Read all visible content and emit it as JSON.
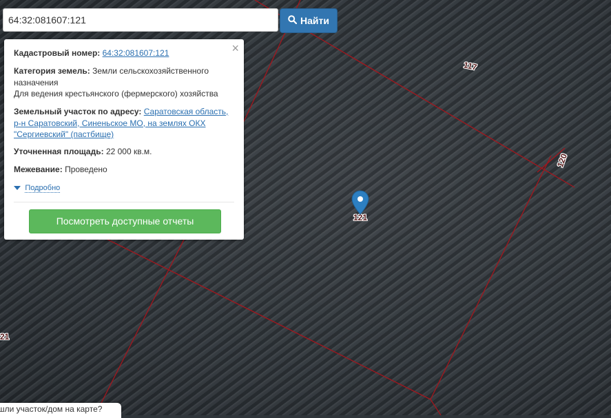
{
  "search": {
    "value": "64:32:081607:121",
    "button_label": "Найти"
  },
  "popup": {
    "cadastral_label": "Кадастровый номер:",
    "cadastral_value": "64:32:081607:121",
    "category_label": "Категория земель:",
    "category_value": "Земли сельскохозяйственного назначения",
    "usage_value": "Для ведения крестьянского (фермерского) хозяйства",
    "address_label": "Земельный участок по адресу:",
    "address_value": "Саратовская область, р-н Саратовский, Синеньское МО, на землях ОКХ \"Сергиевский\" (пастбище)",
    "area_label": "Уточненная площадь:",
    "area_value": "22 000 кв.м.",
    "survey_label": "Межевание:",
    "survey_value": "Проведено",
    "more_label": "Подробно",
    "reports_button": "Посмотреть доступные отчеты",
    "close_symbol": "×"
  },
  "map": {
    "parcel_labels": [
      "117",
      "120",
      "121",
      "21"
    ],
    "boundary_color": "#a3161d",
    "marker_color": "#2d7fc1"
  },
  "bottom_tip": "шли участок/дом на карте?"
}
